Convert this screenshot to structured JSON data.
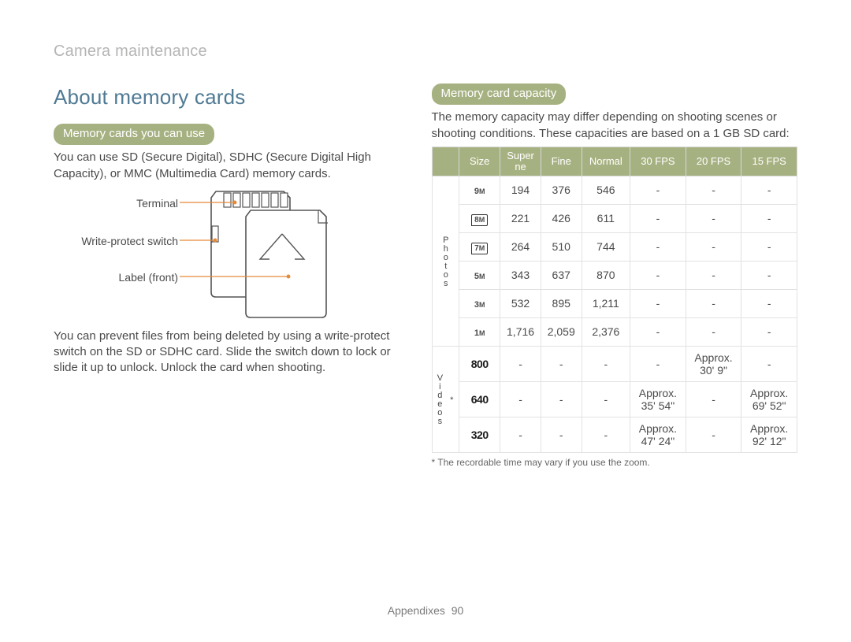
{
  "breadcrumb": "Camera maintenance",
  "heading": "About memory cards",
  "left": {
    "pill": "Memory cards you can use",
    "intro": "You can use SD (Secure Digital), SDHC (Secure Digital High Capacity), or MMC (Multimedia Card) memory cards.",
    "labels": {
      "terminal": "Terminal",
      "wps": "Write-protect switch",
      "front": "Label (front)"
    },
    "write_protect": "You can prevent files from being deleted by using a write-protect switch on the SD or SDHC card. Slide the switch down to lock or slide it up to unlock. Unlock the card when shooting."
  },
  "right": {
    "pill": "Memory card capacity",
    "intro": "The memory capacity may differ depending on shooting scenes or shooting conditions. These capacities are based on a 1 GB SD card:",
    "footnote": "* The recordable time may vary if you use the zoom."
  },
  "table": {
    "headers": [
      "Size",
      "Super\nne",
      "Fine",
      "Normal",
      "30 FPS",
      "20 FPS",
      "15 FPS"
    ],
    "group_photos": "Photos",
    "group_videos": "*\nVideos",
    "photos": [
      {
        "icon": "9M",
        "style": "plain",
        "super": "194",
        "fine": "376",
        "normal": "546",
        "fps30": "-",
        "fps20": "-",
        "fps15": "-"
      },
      {
        "icon": "8M",
        "style": "box",
        "super": "221",
        "fine": "426",
        "normal": "611",
        "fps30": "-",
        "fps20": "-",
        "fps15": "-"
      },
      {
        "icon": "7M",
        "style": "box",
        "super": "264",
        "fine": "510",
        "normal": "744",
        "fps30": "-",
        "fps20": "-",
        "fps15": "-"
      },
      {
        "icon": "5M",
        "style": "plain",
        "super": "343",
        "fine": "637",
        "normal": "870",
        "fps30": "-",
        "fps20": "-",
        "fps15": "-"
      },
      {
        "icon": "3M",
        "style": "plain",
        "super": "532",
        "fine": "895",
        "normal": "1,211",
        "fps30": "-",
        "fps20": "-",
        "fps15": "-"
      },
      {
        "icon": "1M",
        "style": "plain",
        "super": "1,716",
        "fine": "2,059",
        "normal": "2,376",
        "fps30": "-",
        "fps20": "-",
        "fps15": "-"
      }
    ],
    "videos": [
      {
        "label": "800",
        "super": "-",
        "fine": "-",
        "normal": "-",
        "fps30": "-",
        "fps20": "Approx.\n30' 9\"",
        "fps15": "-"
      },
      {
        "label": "640",
        "super": "-",
        "fine": "-",
        "normal": "-",
        "fps30": "Approx.\n35' 54\"",
        "fps20": "-",
        "fps15": "Approx.\n69' 52\""
      },
      {
        "label": "320",
        "super": "-",
        "fine": "-",
        "normal": "-",
        "fps30": "Approx.\n47' 24\"",
        "fps20": "-",
        "fps15": "Approx.\n92' 12\""
      }
    ]
  },
  "pager": {
    "section": "Appendixes",
    "page": "90"
  }
}
